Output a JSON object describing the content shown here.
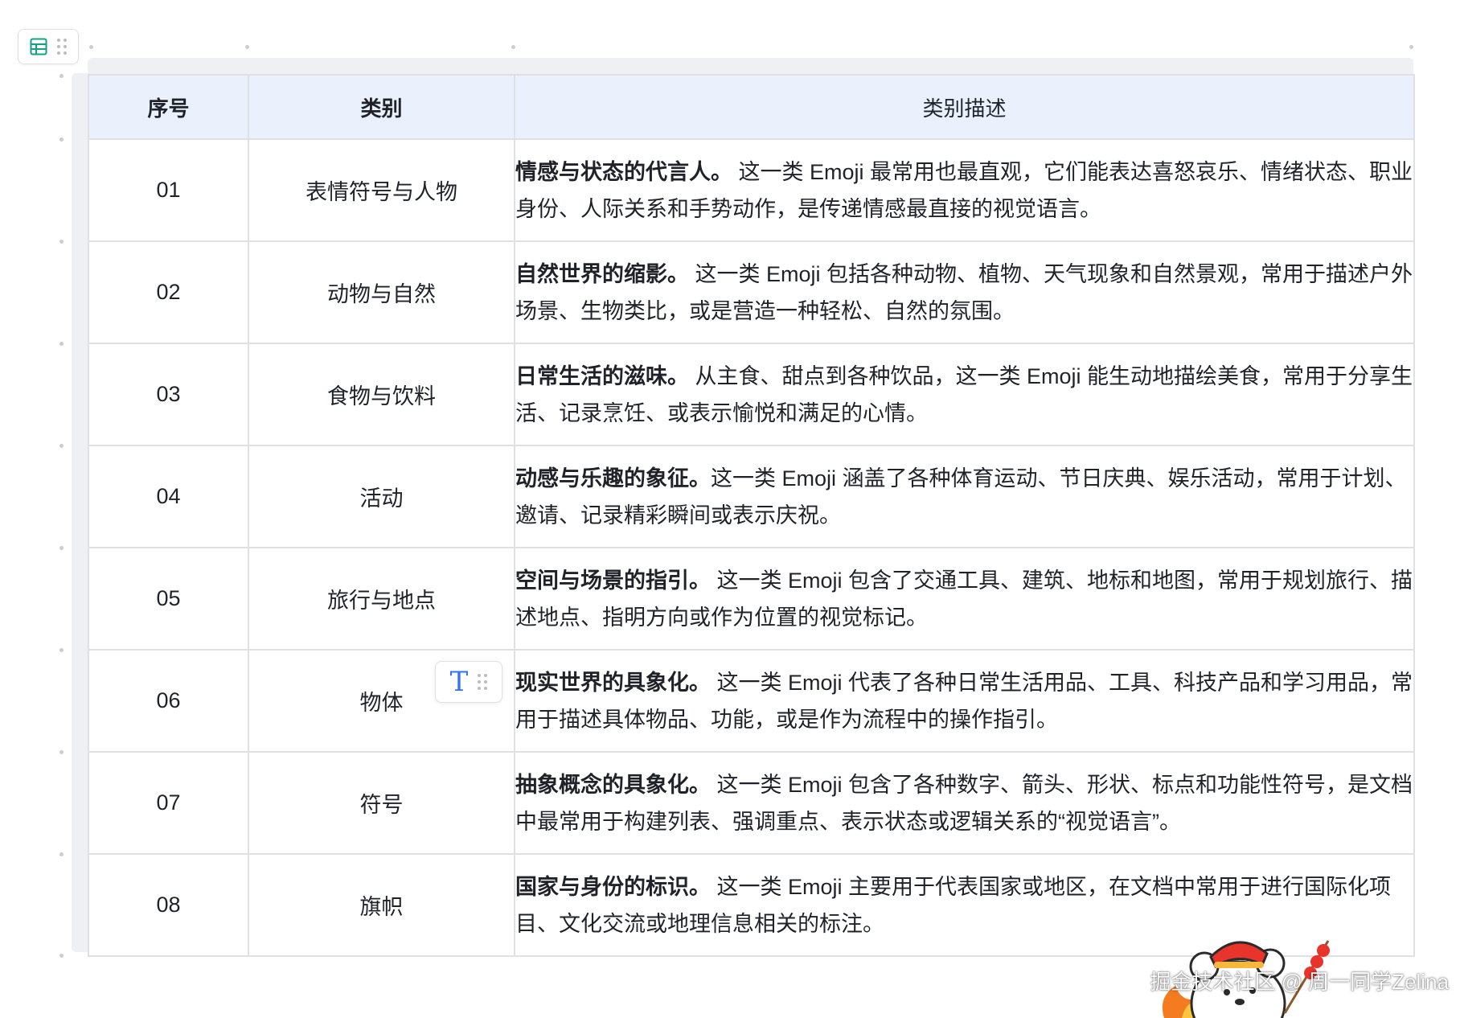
{
  "table": {
    "headers": [
      "序号",
      "类别",
      "类别描述"
    ],
    "rows": [
      {
        "num": "01",
        "category": "表情符号与人物",
        "lead": "情感与状态的代言人。",
        "body": " 这一类 Emoji 最常用也最直观，它们能表达喜怒哀乐、情绪状态、职业身份、人际关系和手势动作，是传递情感最直接的视觉语言。"
      },
      {
        "num": "02",
        "category": "动物与自然",
        "lead": "自然世界的缩影。",
        "body": " 这一类 Emoji 包括各种动物、植物、天气现象和自然景观，常用于描述户外场景、生物类比，或是营造一种轻松、自然的氛围。"
      },
      {
        "num": "03",
        "category": "食物与饮料",
        "lead": "日常生活的滋味。",
        "body": " 从主食、甜点到各种饮品，这一类 Emoji 能生动地描绘美食，常用于分享生活、记录烹饪、或表示愉悦和满足的心情。"
      },
      {
        "num": "04",
        "category": "活动",
        "lead": "动感与乐趣的象征。",
        "body": "这一类 Emoji 涵盖了各种体育运动、节日庆典、娱乐活动，常用于计划、邀请、记录精彩瞬间或表示庆祝。"
      },
      {
        "num": "05",
        "category": "旅行与地点",
        "lead": "空间与场景的指引。",
        "body": " 这一类 Emoji 包含了交通工具、建筑、地标和地图，常用于规划旅行、描述地点、指明方向或作为位置的视觉标记。"
      },
      {
        "num": "06",
        "category": "物体",
        "lead": "现实世界的具象化。",
        "body": " 这一类 Emoji 代表了各种日常生活用品、工具、科技产品和学习用品，常用于描述具体物品、功能，或是作为流程中的操作指引。"
      },
      {
        "num": "07",
        "category": "符号",
        "lead": "抽象概念的具象化。",
        "body": " 这一类 Emoji 包含了各种数字、箭头、形状、标点和功能性符号，是文档中最常用于构建列表、强调重点、表示状态或逻辑关系的“视觉语言”。"
      },
      {
        "num": "08",
        "category": "旗帜",
        "lead": "国家与身份的标识。",
        "body": " 这一类 Emoji 主要用于代表国家或地区，在文档中常用于进行国际化项目、文化交流或地理信息相关的标注。"
      }
    ]
  },
  "cell_toolbar": {
    "glyph": "T",
    "icon": "text-format-icon"
  },
  "table_handle": {
    "icon": "table-icon"
  },
  "watermark": {
    "text": "掘金技术社区 @ 周一同学Zelina"
  },
  "colors": {
    "header_bg": "#eaf1fd",
    "border": "#dee0e3",
    "accent": "#3370ff",
    "handle_icon": "#14a085"
  }
}
